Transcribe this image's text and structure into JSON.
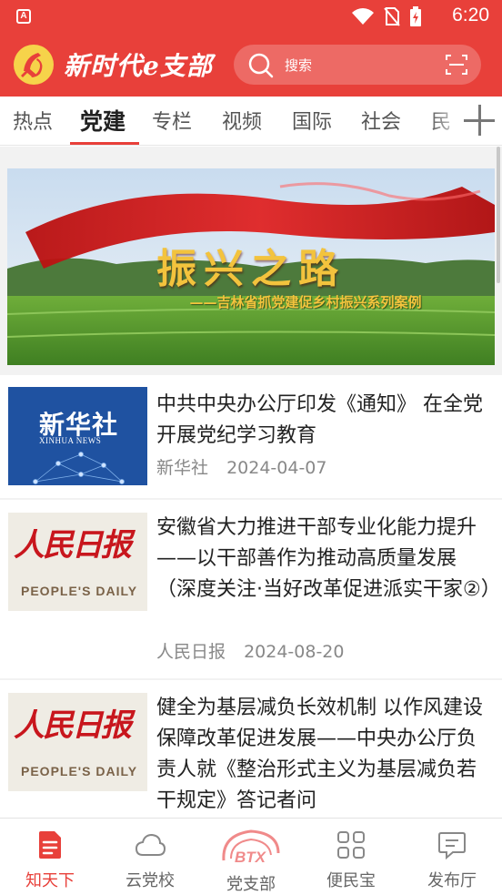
{
  "status_bar": {
    "time": "6:20",
    "app_icon_label": "A"
  },
  "header": {
    "app_title": "新时代e支部",
    "search_placeholder": "搜索"
  },
  "tabs": [
    {
      "label": "热点",
      "active": false
    },
    {
      "label": "党建",
      "active": true
    },
    {
      "label": "专栏",
      "active": false
    },
    {
      "label": "视频",
      "active": false
    },
    {
      "label": "国际",
      "active": false
    },
    {
      "label": "社会",
      "active": false
    },
    {
      "label": "民",
      "active": false
    }
  ],
  "banner": {
    "title": "振兴之路",
    "subtitle": "——吉林省抓党建促乡村振兴系列案例"
  },
  "news": [
    {
      "headline": "中共中央办公厅印发《通知》 在全党开展党纪学习教育",
      "source": "新华社",
      "date": "2024-04-07",
      "thumb_cn": "新华社",
      "thumb_en": "XINHUA NEWS"
    },
    {
      "headline": "安徽省大力推进干部专业化能力提升——以干部善作为推动高质量发展（深度关注·当好改革促进派实干家②）",
      "source": "人民日报",
      "date": "2024-08-20",
      "thumb_cn": "人民日报",
      "thumb_en": "PEOPLE'S DAILY"
    },
    {
      "headline": "健全为基层减负长效机制 以作风建设保障改革促进发展——中央办公厅负责人就《整治形式主义为基层减负若干规定》答记者问",
      "source": "",
      "date": "",
      "thumb_cn": "人民日报",
      "thumb_en": "PEOPLE'S DAILY"
    }
  ],
  "bottom_nav": [
    {
      "label": "知天下",
      "icon": "document-icon",
      "active": true
    },
    {
      "label": "云党校",
      "icon": "cloud-icon",
      "active": false
    },
    {
      "label": "党支部",
      "icon": "btx-logo-icon",
      "badge_text": "BTX",
      "active": false
    },
    {
      "label": "便民宝",
      "icon": "grid-icon",
      "active": false
    },
    {
      "label": "发布厅",
      "icon": "message-icon",
      "active": false
    }
  ],
  "colors": {
    "brand_red": "#e8403a",
    "accent_gold": "#f3c33d"
  }
}
